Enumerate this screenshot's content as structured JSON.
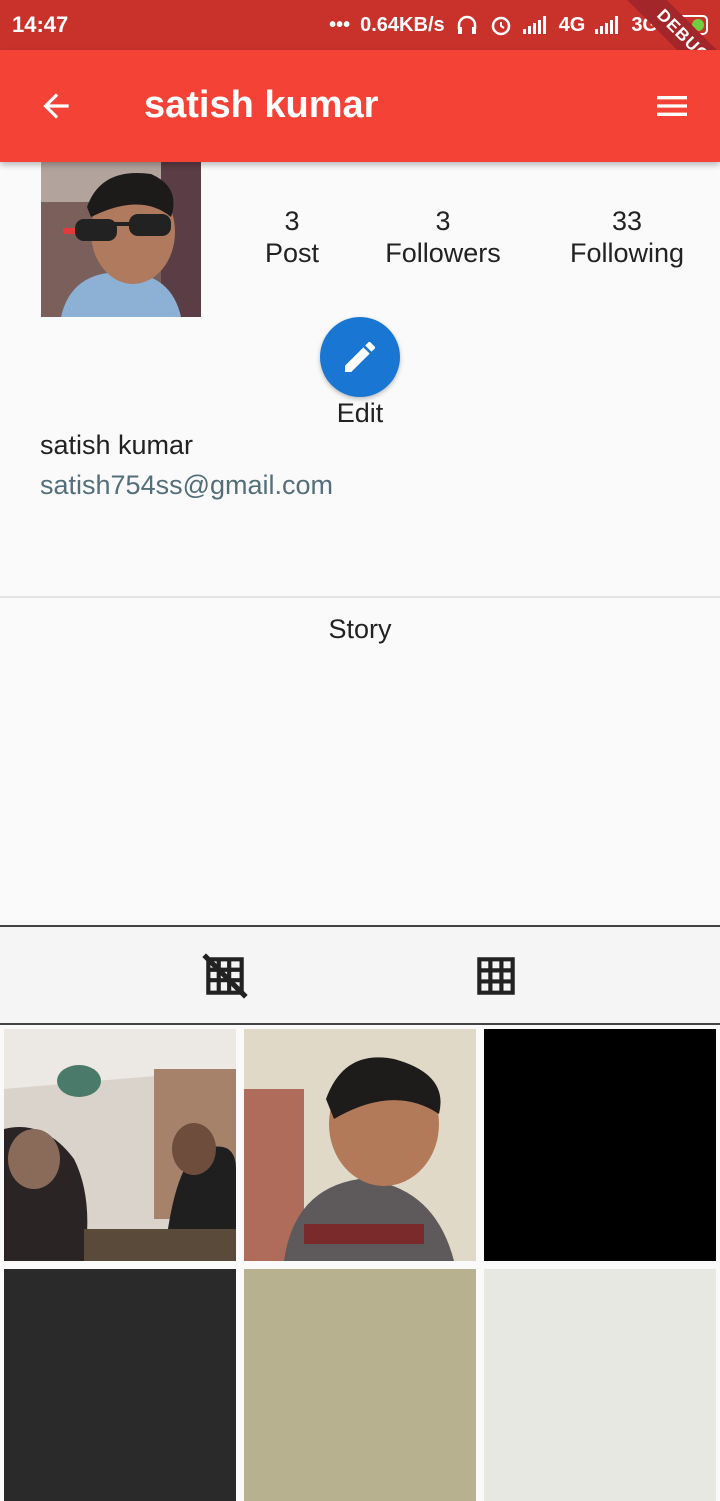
{
  "status_bar": {
    "time": "14:47",
    "network_speed": "0.64KB/s",
    "net1": "4G",
    "net2": "3G",
    "debug_label": "DEBUG",
    "icons": [
      "dots-icon",
      "headphones-icon",
      "alarm-icon",
      "signal-icon",
      "battery-charging-icon"
    ]
  },
  "app_bar": {
    "title": "satish kumar",
    "back_icon": "arrow-back-icon",
    "menu_icon": "menu-icon"
  },
  "profile": {
    "stats": [
      {
        "count": "3",
        "label": "Post"
      },
      {
        "count": "3",
        "label": "Followers"
      },
      {
        "count": "33",
        "label": "Following"
      }
    ],
    "edit_label": "Edit",
    "name": "satish kumar",
    "email": "satish754ss@gmail.com"
  },
  "story": {
    "label": "Story"
  },
  "tabs": [
    {
      "icon": "grid-off-icon"
    },
    {
      "icon": "grid-on-icon"
    }
  ],
  "colors": {
    "app_bar": "#f44336",
    "status_bar": "#c9322b",
    "edit_button": "#1976d2",
    "email_text": "#546e7a"
  }
}
